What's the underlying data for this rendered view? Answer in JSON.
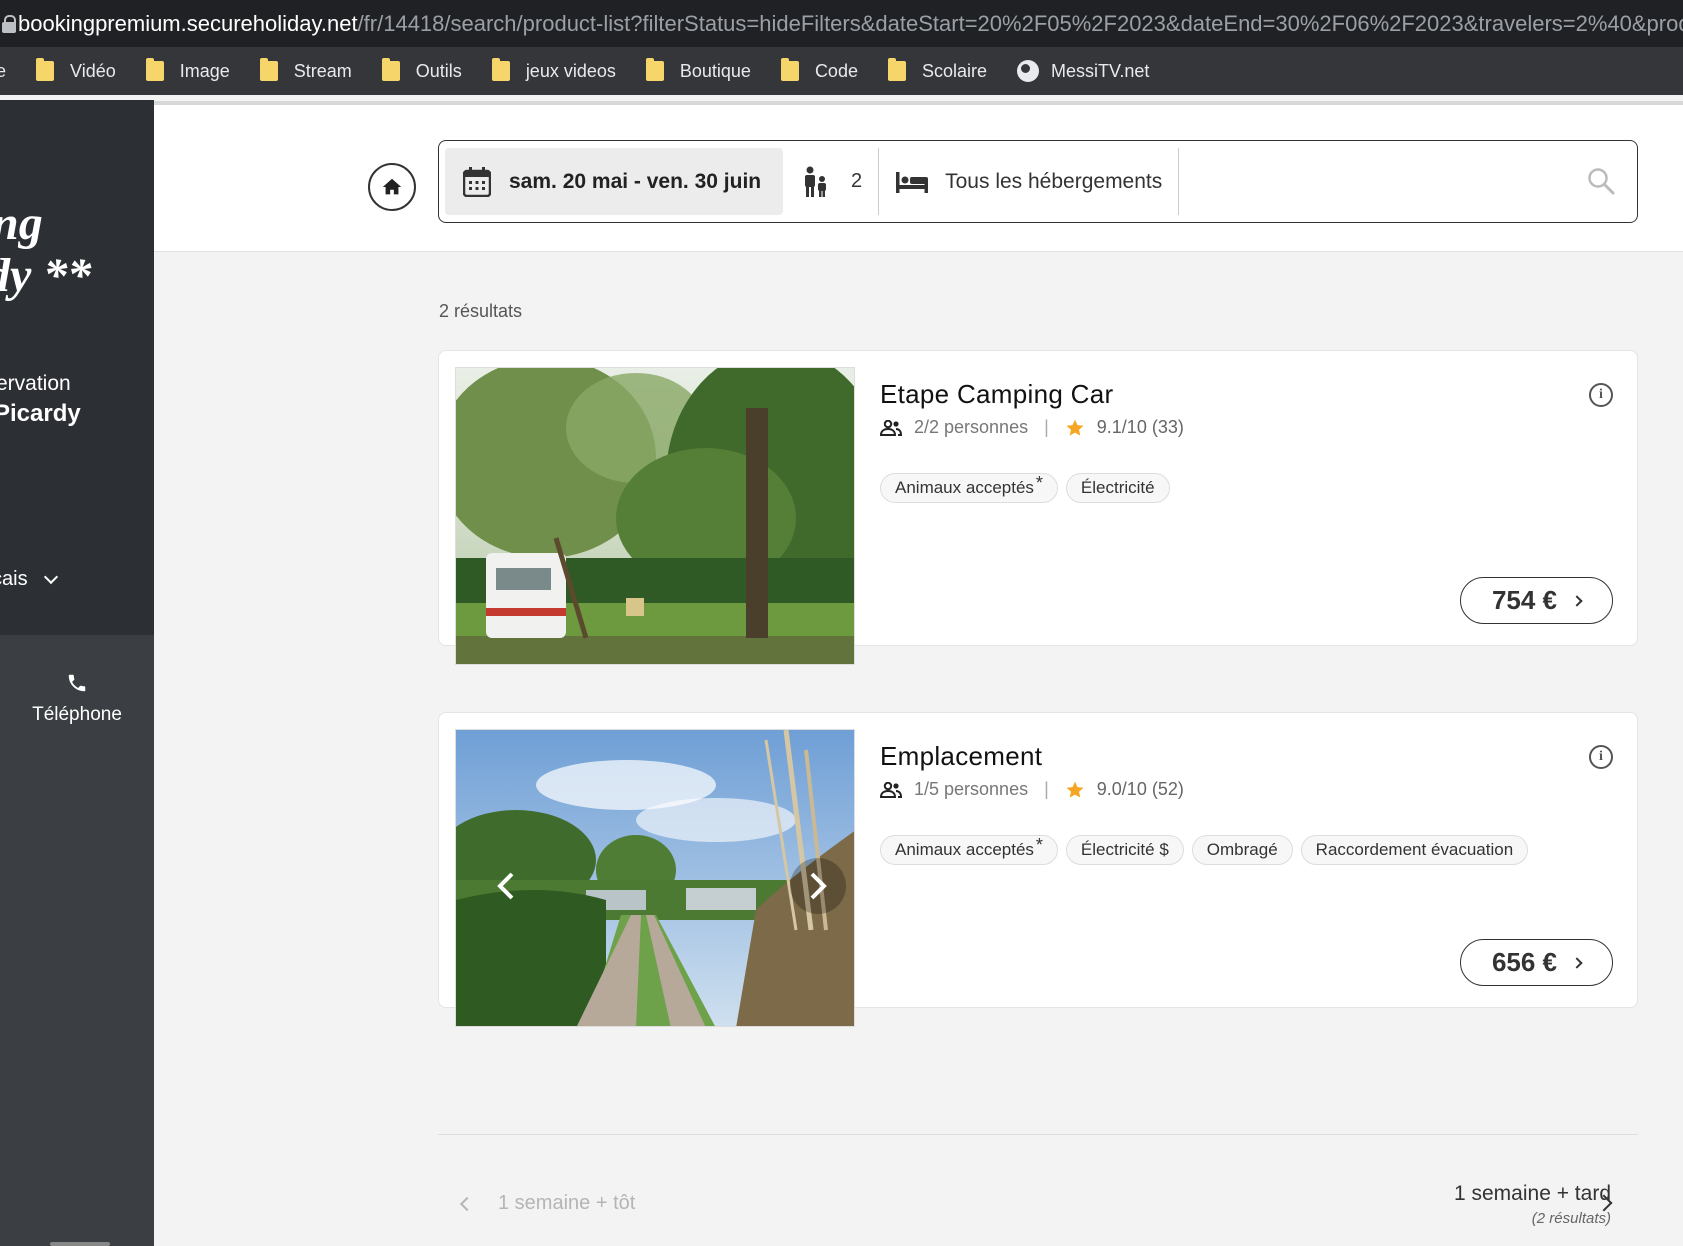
{
  "browser": {
    "url_host": "bookingpremium.secureholiday.net",
    "url_path": "/fr/14418/search/product-list?filterStatus=hideFilters&dateStart=20%2F05%2F2023&dateEnd=30%2F06%2F2023&travelers=2%40&productTyp",
    "bookmarks": [
      {
        "label": "e",
        "icon": "folder-icon"
      },
      {
        "label": "Vidéo",
        "icon": "folder-icon"
      },
      {
        "label": "Image",
        "icon": "folder-icon"
      },
      {
        "label": "Stream",
        "icon": "folder-icon"
      },
      {
        "label": "Outils",
        "icon": "folder-icon"
      },
      {
        "label": "jeux videos",
        "icon": "folder-icon"
      },
      {
        "label": "Boutique",
        "icon": "folder-icon"
      },
      {
        "label": "Code",
        "icon": "folder-icon"
      },
      {
        "label": "Scolaire",
        "icon": "folder-icon"
      },
      {
        "label": "MessiTV.net",
        "icon": "globe-icon"
      }
    ]
  },
  "sidebar": {
    "logo_line1": "ng",
    "logo_line2": "dy **",
    "reservation_label": "ervation",
    "site_name": "Picardy",
    "language": "çais",
    "phone_label": "Téléphone"
  },
  "search": {
    "dates": "sam. 20 mai - ven. 30 juin",
    "travelers": "2",
    "accommodation_type": "Tous les hébergements"
  },
  "results": {
    "count_label": "2 résultats",
    "items": [
      {
        "title": "Etape Camping Car",
        "capacity": "2/2 personnes",
        "rating": "9.1/10 (33)",
        "tags": [
          "Animaux acceptés",
          "Électricité"
        ],
        "tag_asterisk": "*",
        "price": "754 €"
      },
      {
        "title": "Emplacement",
        "capacity": "1/5 personnes",
        "rating": "9.0/10 (52)",
        "tags": [
          "Animaux acceptés",
          "Électricité $",
          "Ombragé",
          "Raccordement évacuation"
        ],
        "tag_asterisk": "*",
        "price": "656 €"
      }
    ]
  },
  "pagination": {
    "prev_label": "1 semaine + tôt",
    "next_label": "1 semaine + tard",
    "next_sub": "(2 résultats)"
  },
  "colors": {
    "star": "#f5a623",
    "sidebar_dark": "#2c2f33",
    "sidebar_mid": "#3b3e42"
  }
}
